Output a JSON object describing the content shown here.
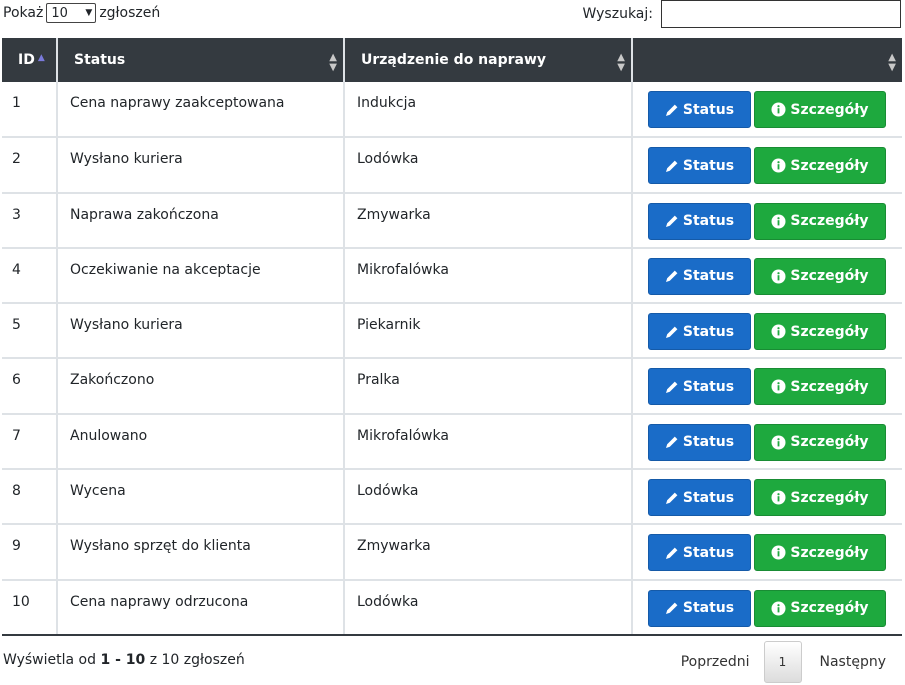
{
  "controls": {
    "show_label": "Pokaż",
    "page_size": "10",
    "entries_label": "zgłoszeń",
    "search_label": "Wyszukaj:",
    "search_value": ""
  },
  "table": {
    "headers": {
      "id": "ID",
      "status": "Status",
      "device": "Urządzenie do naprawy",
      "actions": ""
    },
    "sorted_column": "ID",
    "sort_direction": "ascending",
    "status_button_label": "Status",
    "details_button_label": "Szczegóły",
    "rows": [
      {
        "id": "1",
        "status": "Cena naprawy zaakceptowana",
        "device": "Indukcja"
      },
      {
        "id": "2",
        "status": "Wysłano kuriera",
        "device": "Lodówka"
      },
      {
        "id": "3",
        "status": "Naprawa zakończona",
        "device": "Zmywarka"
      },
      {
        "id": "4",
        "status": "Oczekiwanie na akceptacje",
        "device": "Mikrofalówka"
      },
      {
        "id": "5",
        "status": "Wysłano kuriera",
        "device": "Piekarnik"
      },
      {
        "id": "6",
        "status": "Zakończono",
        "device": "Pralka"
      },
      {
        "id": "7",
        "status": "Anulowano",
        "device": "Mikrofalówka"
      },
      {
        "id": "8",
        "status": "Wycena",
        "device": "Lodówka"
      },
      {
        "id": "9",
        "status": "Wysłano sprzęt do klienta",
        "device": "Zmywarka"
      },
      {
        "id": "10",
        "status": "Cena naprawy odrzucona",
        "device": "Lodówka"
      }
    ]
  },
  "footer": {
    "info_prefix": "Wyświetla od",
    "range": "1 - 10",
    "info_of": "z",
    "total": "10",
    "info_suffix": "zgłoszeń"
  },
  "pagination": {
    "previous": "Poprzedni",
    "current_page": "1",
    "next": "Następny"
  },
  "colors": {
    "header_bg": "#343a40",
    "status_button": "#1a6cc8",
    "details_button": "#1ea93e"
  },
  "icons": {
    "status_button": "pen-icon",
    "details_button": "info-circle-icon",
    "sort": "sort-arrows-icon"
  }
}
